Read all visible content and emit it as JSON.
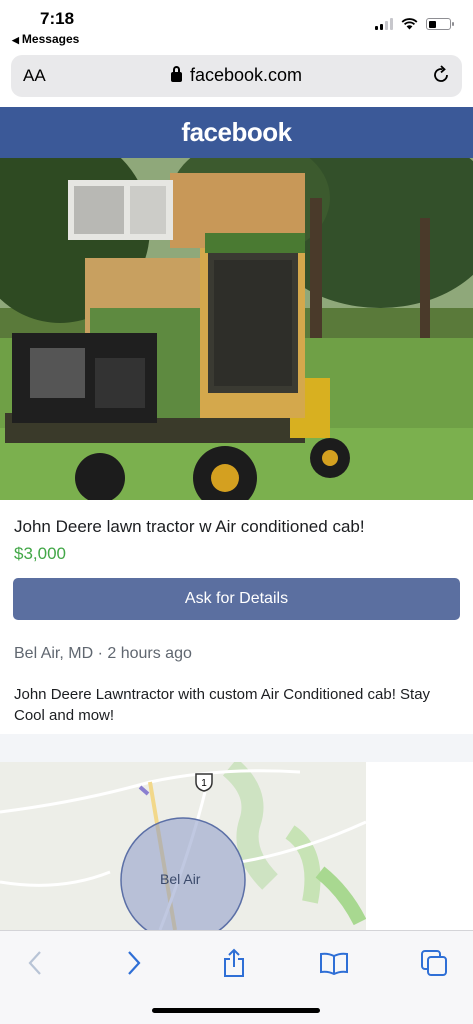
{
  "status_bar": {
    "time": "7:18",
    "back_app": "Messages"
  },
  "browser": {
    "text_size_label": "AA",
    "url": "facebook.com"
  },
  "site": {
    "logo": "facebook",
    "brand_color": "#3b5998"
  },
  "listing": {
    "title": "John Deere lawn tractor w Air conditioned cab!",
    "price": "$3,000",
    "price_color": "#42a747",
    "ask_button": "Ask for Details",
    "location": "Bel Air, MD · 2 hours ago",
    "description": "John Deere Lawntractor with custom Air Conditioned cab! Stay Cool and mow!"
  },
  "map": {
    "place_label": "Bel Air",
    "route_number": "1"
  },
  "toolbar": {
    "icons": [
      "back-arrow-icon",
      "forward-arrow-icon",
      "share-icon",
      "bookmarks-icon",
      "tabs-icon"
    ]
  }
}
